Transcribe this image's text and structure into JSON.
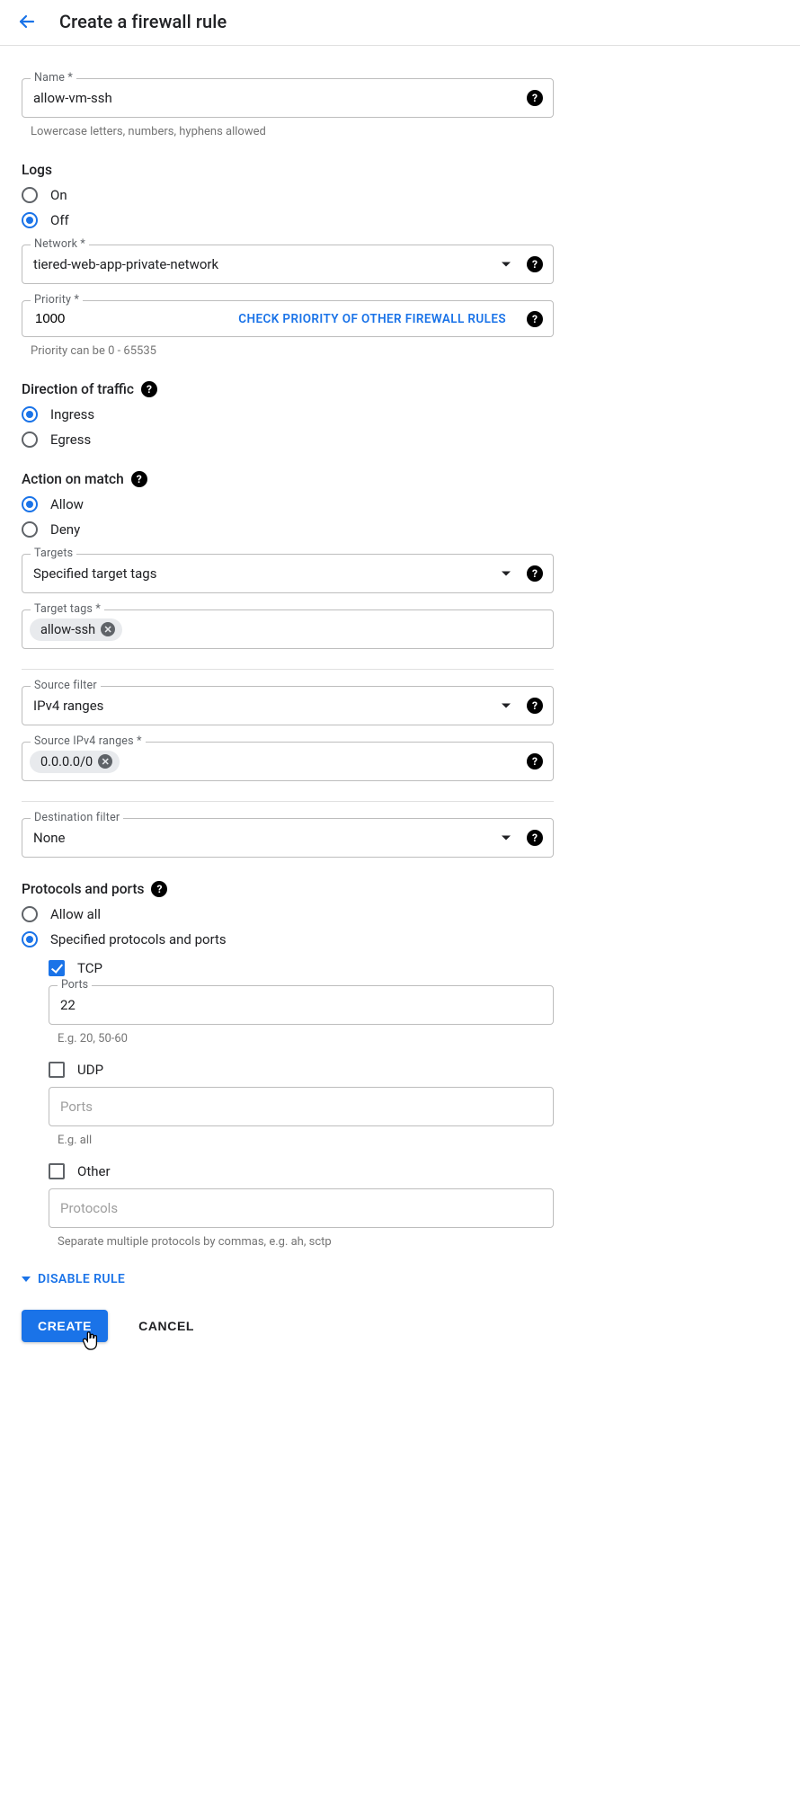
{
  "header": {
    "title": "Create a firewall rule"
  },
  "name": {
    "label": "Name *",
    "value": "allow-vm-ssh",
    "helper": "Lowercase letters, numbers, hyphens allowed"
  },
  "logs": {
    "label": "Logs",
    "on": "On",
    "off": "Off",
    "selected": "off"
  },
  "network": {
    "label": "Network *",
    "value": "tiered-web-app-private-network"
  },
  "priority": {
    "label": "Priority *",
    "value": "1000",
    "link": "CHECK PRIORITY OF OTHER FIREWALL RULES",
    "helper": "Priority can be 0 - 65535"
  },
  "direction": {
    "label": "Direction of traffic",
    "ingress": "Ingress",
    "egress": "Egress"
  },
  "action": {
    "label": "Action on match",
    "allow": "Allow",
    "deny": "Deny"
  },
  "targets": {
    "label": "Targets",
    "value": "Specified target tags"
  },
  "targetTags": {
    "label": "Target tags *",
    "chips": [
      "allow-ssh"
    ]
  },
  "sourceFilter": {
    "label": "Source filter",
    "value": "IPv4 ranges"
  },
  "sourceRanges": {
    "label": "Source IPv4 ranges *",
    "chips": [
      "0.0.0.0/0"
    ]
  },
  "destFilter": {
    "label": "Destination filter",
    "value": "None"
  },
  "protocols": {
    "label": "Protocols and ports",
    "allowAll": "Allow all",
    "specified": "Specified protocols and ports",
    "tcp": {
      "label": "TCP",
      "checked": true,
      "portsLabel": "Ports",
      "ports": "22",
      "helper": "E.g. 20, 50-60"
    },
    "udp": {
      "label": "UDP",
      "checked": false,
      "placeholder": "Ports",
      "helper": "E.g. all"
    },
    "other": {
      "label": "Other",
      "checked": false,
      "placeholder": "Protocols",
      "helper": "Separate multiple protocols by commas, e.g. ah, sctp"
    }
  },
  "disableRule": "DISABLE RULE",
  "buttons": {
    "create": "CREATE",
    "cancel": "CANCEL"
  }
}
